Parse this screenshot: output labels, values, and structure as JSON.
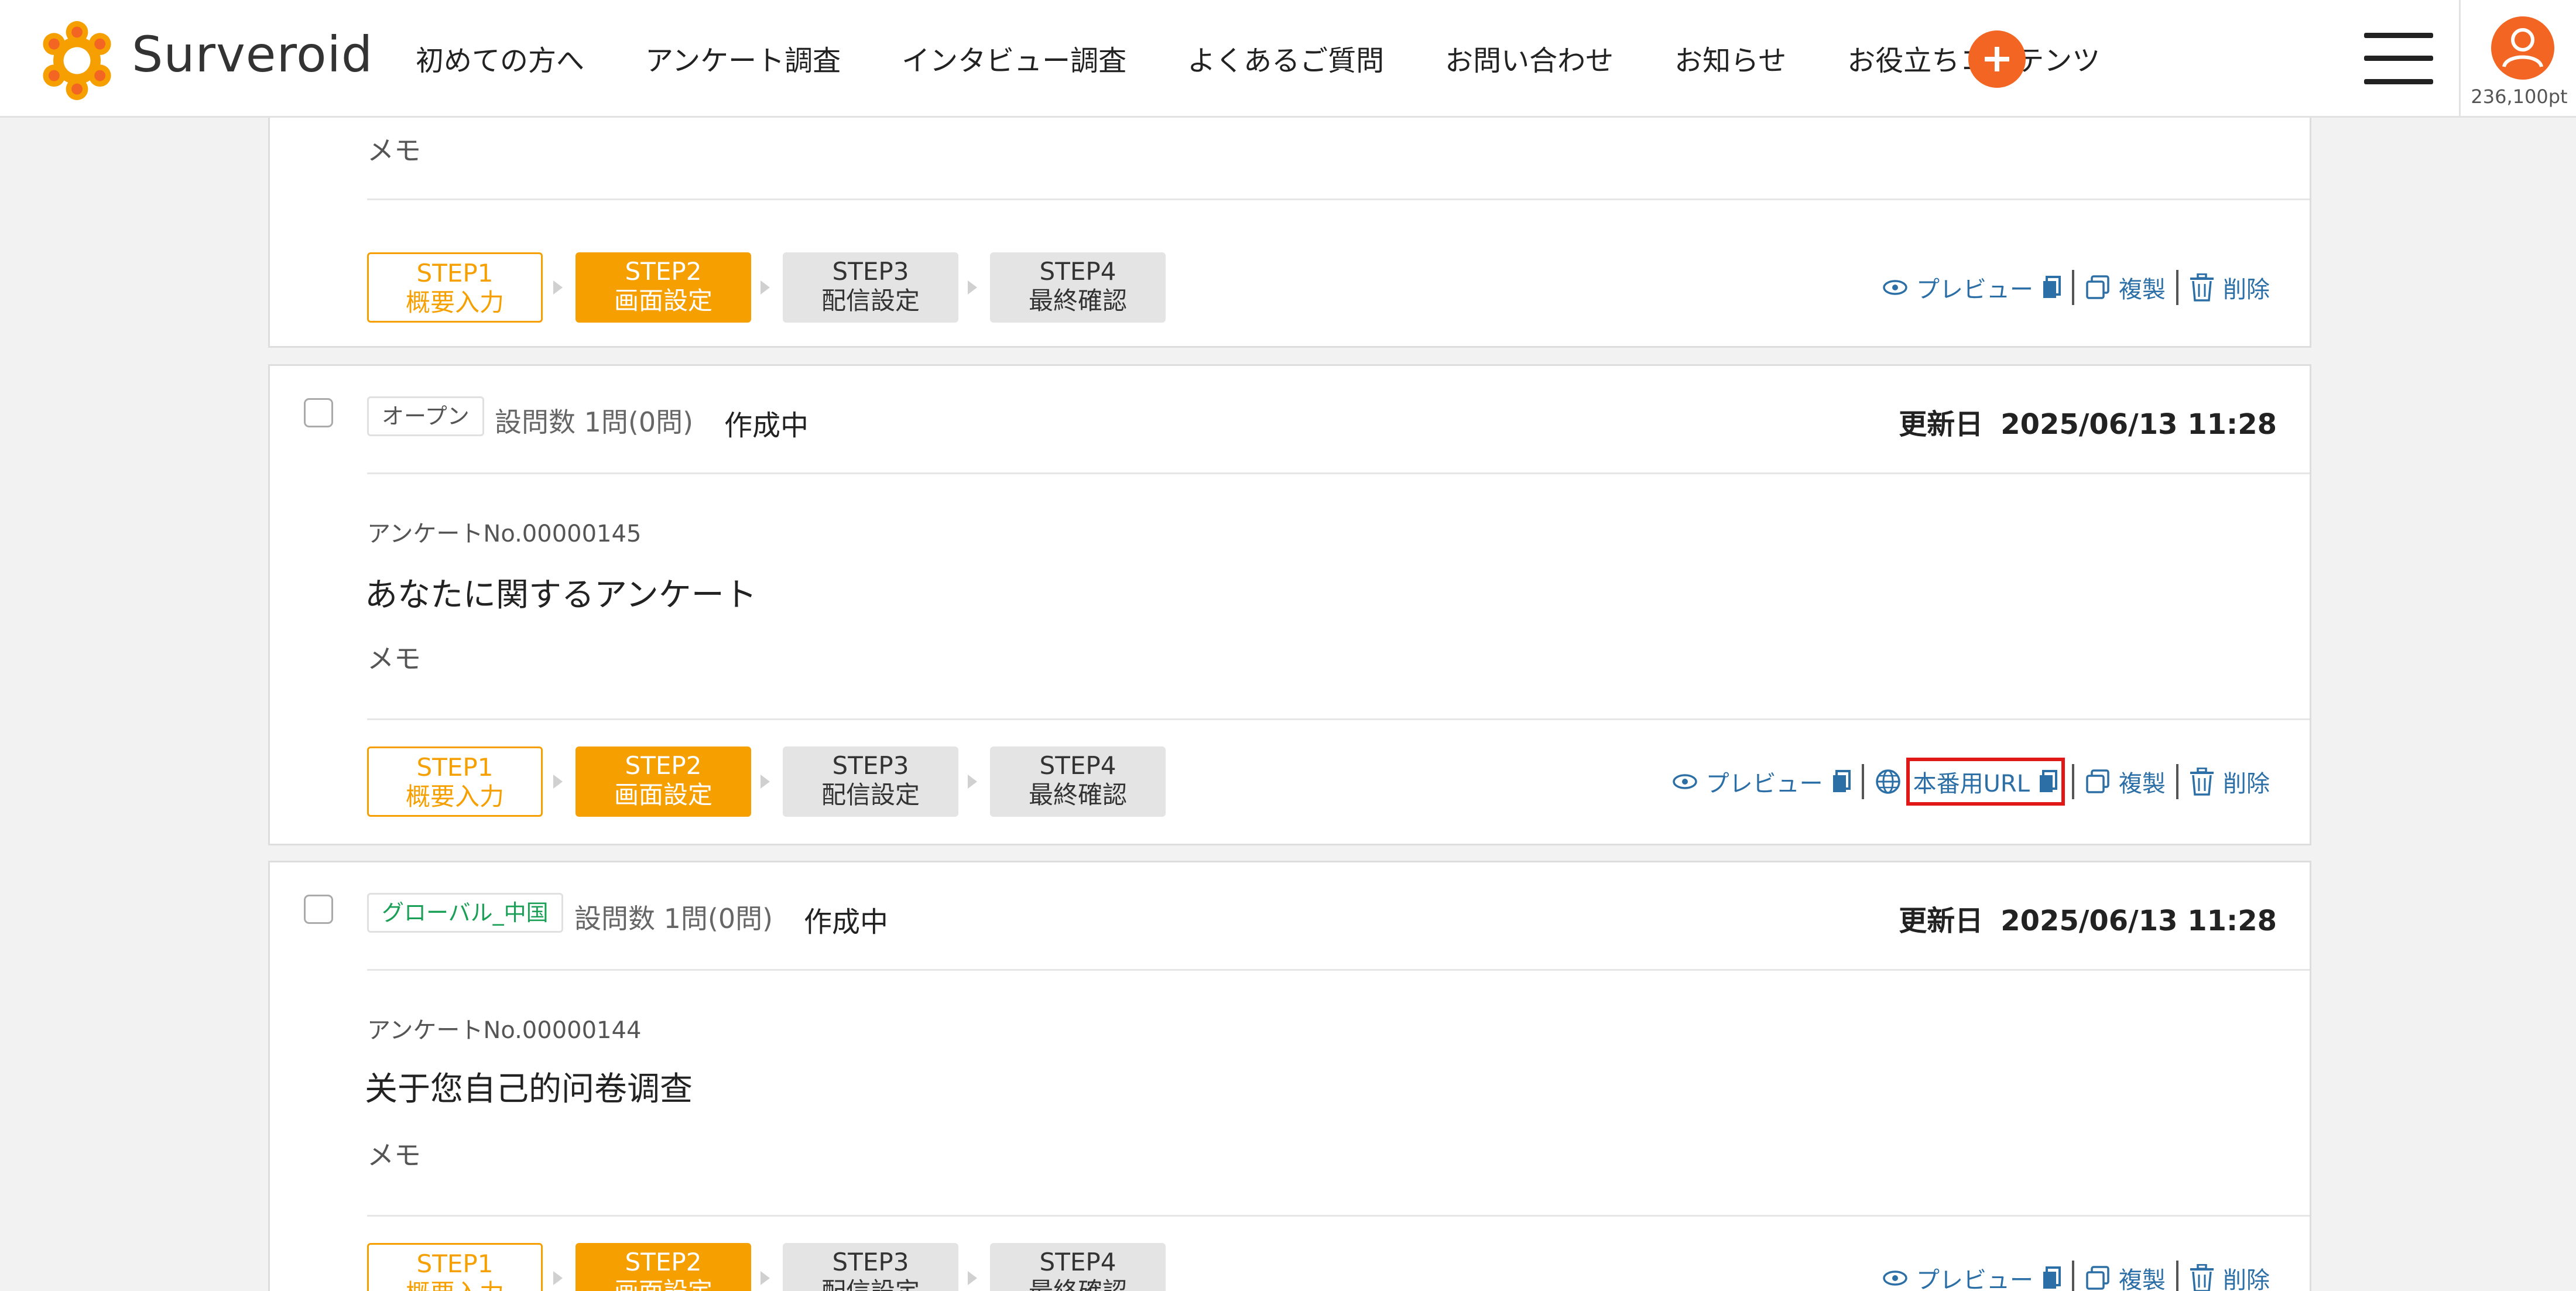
{
  "header": {
    "logo_text": "Surveroid",
    "nav": [
      "初めての方へ",
      "アンケート調査",
      "インタビュー調査",
      "よくあるご質問",
      "お問い合わせ",
      "お知らせ",
      "お役立ちコンテンツ"
    ],
    "points": "236,100pt",
    "accent_color": "#f26522"
  },
  "steps": [
    {
      "line1": "STEP1",
      "line2": "概要入力"
    },
    {
      "line1": "STEP2",
      "line2": "画面設定"
    },
    {
      "line1": "STEP3",
      "line2": "配信設定"
    },
    {
      "line1": "STEP4",
      "line2": "最終確認"
    }
  ],
  "actions": {
    "preview": "プレビュー",
    "prod_url": "本番用URL",
    "duplicate": "複製",
    "delete": "削除"
  },
  "cards": [
    {
      "memo": "メモ"
    },
    {
      "tag": "オープン",
      "questions": "設問数 1問(0問)",
      "status": "作成中",
      "updated_label": "更新日",
      "updated_value": "2025/06/13 11:28",
      "survey_no": "アンケートNo.00000145",
      "title": "あなたに関するアンケート",
      "memo": "メモ"
    },
    {
      "tag": "グローバル_中国",
      "questions": "設問数 1問(0問)",
      "status": "作成中",
      "updated_label": "更新日",
      "updated_value": "2025/06/13 11:28",
      "survey_no": "アンケートNo.00000144",
      "title": "关于您自己的问卷调查",
      "memo": "メモ"
    }
  ]
}
